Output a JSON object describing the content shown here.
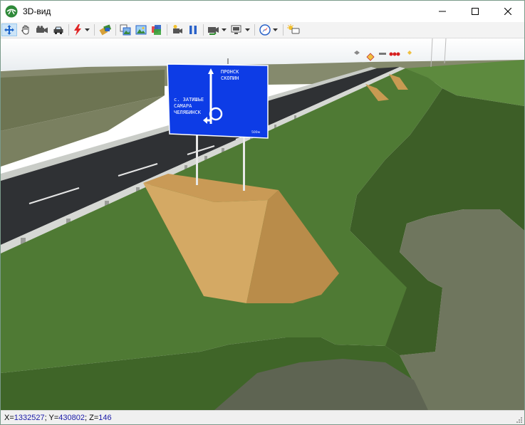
{
  "window": {
    "title": "3D-вид"
  },
  "toolbar": {
    "buttons": [
      {
        "icon": "move-icon"
      },
      {
        "icon": "hand-icon"
      },
      {
        "icon": "camera-icon"
      },
      {
        "icon": "car-icon"
      },
      {
        "icon": "lightning-icon"
      },
      {
        "icon": "paint-icon"
      },
      {
        "icon": "copy-view-icon"
      },
      {
        "icon": "image-icon"
      },
      {
        "icon": "layers-icon"
      },
      {
        "icon": "record-icon"
      },
      {
        "icon": "pause-icon"
      },
      {
        "icon": "video-export-icon"
      },
      {
        "icon": "screen-export-icon"
      },
      {
        "icon": "compass-icon"
      },
      {
        "icon": "light-icon"
      }
    ]
  },
  "sign": {
    "top_line1": "ПРОНСК",
    "top_line2": "СКОПИН",
    "left_line1": "с. ЗАТИШЬЕ",
    "left_line2": "САМАРА",
    "left_line3": "ЧЕЛЯБИНСК",
    "distance": "500м"
  },
  "status": {
    "x_label": "X=",
    "x_value": "1332527",
    "y_label": "; Y=",
    "y_value": "430802",
    "z_label": "; Z=",
    "z_value": "146"
  },
  "colors": {
    "sign_blue": "#0d3ce6",
    "grass": "#4f7a34",
    "sand": "#c89a52",
    "asphalt": "#2f3134",
    "value_blue": "#1a1aa8"
  }
}
